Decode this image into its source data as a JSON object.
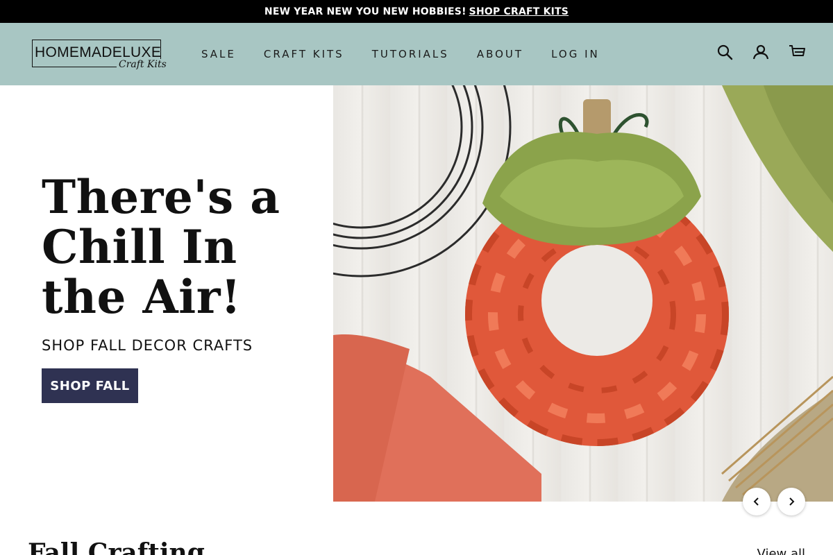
{
  "announcement": {
    "text": "NEW YEAR NEW YOU NEW HOBBIES!",
    "link": "SHOP CRAFT KITS"
  },
  "header": {
    "logo_text": "HOMEMADELUXE",
    "logo_script": "Craft Kits",
    "nav": [
      "SALE",
      "CRAFT KITS",
      "TUTORIALS",
      "ABOUT",
      "LOG IN"
    ],
    "icons": [
      "search-icon",
      "account-icon",
      "cart-icon"
    ],
    "background_color": "#a8c6c3"
  },
  "hero": {
    "title": "There's a Chill In the Air!",
    "subtitle": "SHOP FALL DECOR CRAFTS",
    "button": "SHOP FALL",
    "button_color": "#2f3252"
  },
  "slider": {
    "prev_icon": "chevron-left-icon",
    "next_icon": "chevron-right-icon"
  },
  "section": {
    "title": "Fall Crafting",
    "view_all": "View all"
  }
}
